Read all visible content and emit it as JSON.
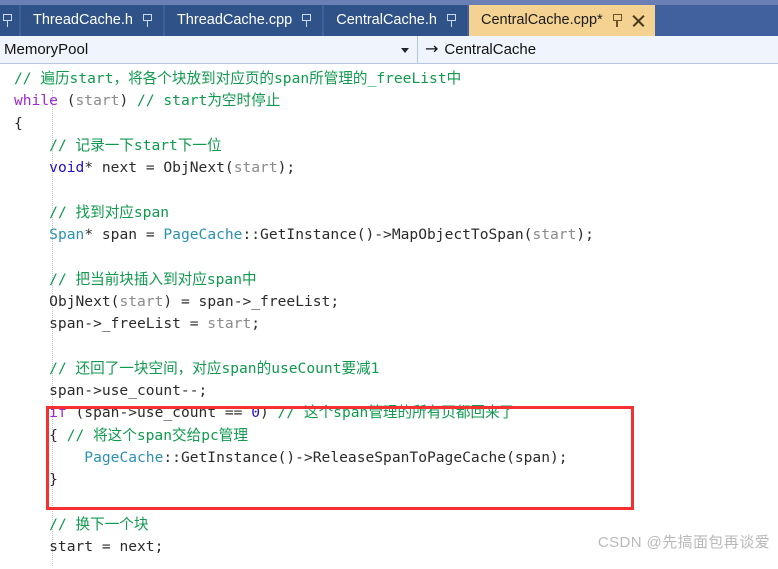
{
  "window": {
    "app": "visual-studio-code-editor"
  },
  "tabs": {
    "items": [
      {
        "label": "",
        "pinned": true,
        "closable": false,
        "active": false,
        "partial": true
      },
      {
        "label": "ThreadCache.h",
        "pinned": true,
        "closable": false,
        "active": false,
        "partial": false
      },
      {
        "label": "ThreadCache.cpp",
        "pinned": true,
        "closable": false,
        "active": false,
        "partial": false
      },
      {
        "label": "CentralCache.h",
        "pinned": true,
        "closable": false,
        "active": false,
        "partial": false
      },
      {
        "label": "CentralCache.cpp*",
        "pinned": true,
        "closable": true,
        "active": true,
        "partial": false
      }
    ]
  },
  "navbar": {
    "scope_value": "MemoryPool",
    "scope_caret": "chevron-down-icon",
    "member_arrow": "→",
    "member_value": "CentralCache"
  },
  "code": {
    "lines": [
      [
        {
          "t": "// 遍历start，将各个块放到对应页的span所管理的_freeList中",
          "c": "c"
        }
      ],
      [
        {
          "t": "while",
          "c": "kwp"
        },
        {
          "t": " (",
          "c": "op"
        },
        {
          "t": "start",
          "c": "pm"
        },
        {
          "t": ") ",
          "c": "op"
        },
        {
          "t": "// start为空时停止",
          "c": "c"
        }
      ],
      [
        {
          "t": "{",
          "c": "op"
        }
      ],
      [
        {
          "t": "    ",
          "c": "op"
        },
        {
          "t": "// 记录一下start下一位",
          "c": "c"
        }
      ],
      [
        {
          "t": "    ",
          "c": "op"
        },
        {
          "t": "void",
          "c": "kw"
        },
        {
          "t": "* next = ",
          "c": "op"
        },
        {
          "t": "ObjNext",
          "c": "id"
        },
        {
          "t": "(",
          "c": "op"
        },
        {
          "t": "start",
          "c": "pm"
        },
        {
          "t": ");",
          "c": "op"
        }
      ],
      [
        {
          "t": "",
          "c": "op"
        }
      ],
      [
        {
          "t": "    ",
          "c": "op"
        },
        {
          "t": "// 找到对应span",
          "c": "c"
        }
      ],
      [
        {
          "t": "    ",
          "c": "op"
        },
        {
          "t": "Span",
          "c": "ty"
        },
        {
          "t": "* span = ",
          "c": "op"
        },
        {
          "t": "PageCache",
          "c": "ty"
        },
        {
          "t": "::",
          "c": "op"
        },
        {
          "t": "GetInstance",
          "c": "id"
        },
        {
          "t": "()->",
          "c": "op"
        },
        {
          "t": "MapObjectToSpan",
          "c": "id"
        },
        {
          "t": "(",
          "c": "op"
        },
        {
          "t": "start",
          "c": "pm"
        },
        {
          "t": ");",
          "c": "op"
        }
      ],
      [
        {
          "t": "",
          "c": "op"
        }
      ],
      [
        {
          "t": "    ",
          "c": "op"
        },
        {
          "t": "// 把当前块插入到对应span中",
          "c": "c"
        }
      ],
      [
        {
          "t": "    ",
          "c": "op"
        },
        {
          "t": "ObjNext",
          "c": "id"
        },
        {
          "t": "(",
          "c": "op"
        },
        {
          "t": "start",
          "c": "pm"
        },
        {
          "t": ") = span->_freeList;",
          "c": "op"
        }
      ],
      [
        {
          "t": "    span->_freeList = ",
          "c": "op"
        },
        {
          "t": "start",
          "c": "pm"
        },
        {
          "t": ";",
          "c": "op"
        }
      ],
      [
        {
          "t": "",
          "c": "op"
        }
      ],
      [
        {
          "t": "    ",
          "c": "op"
        },
        {
          "t": "// 还回了一块空间，对应span的useCount要减1",
          "c": "c"
        }
      ],
      [
        {
          "t": "    span->use_count--;",
          "c": "op"
        }
      ],
      [
        {
          "t": "    ",
          "c": "op"
        },
        {
          "t": "if",
          "c": "kwp"
        },
        {
          "t": " (span->use_count == ",
          "c": "op"
        },
        {
          "t": "0",
          "c": "num"
        },
        {
          "t": ") ",
          "c": "op"
        },
        {
          "t": "// 这个span管理的所有页都回来了",
          "c": "c"
        }
      ],
      [
        {
          "t": "    { ",
          "c": "op"
        },
        {
          "t": "// 将这个span交给pc管理",
          "c": "c"
        }
      ],
      [
        {
          "t": "        ",
          "c": "op"
        },
        {
          "t": "PageCache",
          "c": "ty"
        },
        {
          "t": "::",
          "c": "op"
        },
        {
          "t": "GetInstance",
          "c": "id"
        },
        {
          "t": "()->",
          "c": "op"
        },
        {
          "t": "ReleaseSpanToPageCache",
          "c": "id"
        },
        {
          "t": "(span);",
          "c": "op"
        }
      ],
      [
        {
          "t": "    }",
          "c": "op"
        }
      ],
      [
        {
          "t": "",
          "c": "op"
        }
      ],
      [
        {
          "t": "    ",
          "c": "op"
        },
        {
          "t": "// 换下一个块",
          "c": "c"
        }
      ],
      [
        {
          "t": "    start = ",
          "c": "op"
        },
        {
          "t": "next",
          "c": "id"
        },
        {
          "t": ";",
          "c": "op"
        }
      ]
    ]
  },
  "annotation": {
    "red_box_color": "#f43030"
  },
  "watermark": {
    "text": "CSDN @先搞面包再谈爱"
  }
}
